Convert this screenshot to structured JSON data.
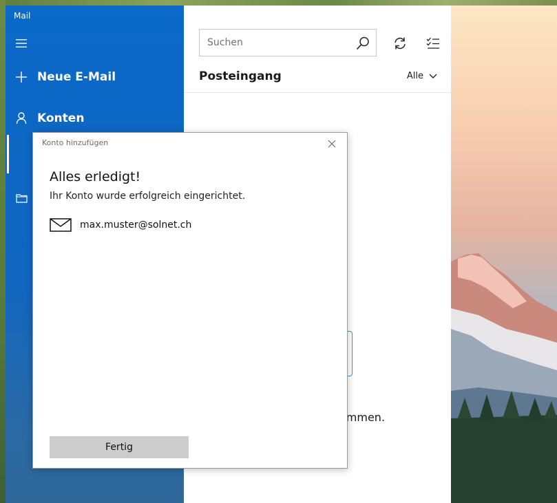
{
  "app": {
    "title": "Mail"
  },
  "nav": {
    "new_mail_label": "Neue E-Mail",
    "accounts_label": "Konten"
  },
  "list": {
    "search_placeholder": "Suchen",
    "inbox_title": "Posteingang",
    "filter_label": "Alle",
    "welcome_fragment": "ommen."
  },
  "dialog": {
    "title": "Konto hinzufügen",
    "heading": "Alles erledigt!",
    "subtitle": "Ihr Konto wurde erfolgreich eingerichtet.",
    "account_email": "max.muster@solnet.ch",
    "done_label": "Fertig"
  },
  "colors": {
    "nav_blue": "#0a69c9",
    "button_gray": "#cccccc",
    "focus_blue": "#3c8fd6"
  },
  "icons": {
    "menu": "hamburger-icon",
    "new_mail": "plus-icon",
    "accounts": "person-icon",
    "folders": "folder-icon",
    "search": "search-icon",
    "sync": "sync-icon",
    "select": "select-all-icon",
    "filter": "chevron-down-icon",
    "close": "close-icon",
    "mail": "envelope-icon"
  }
}
